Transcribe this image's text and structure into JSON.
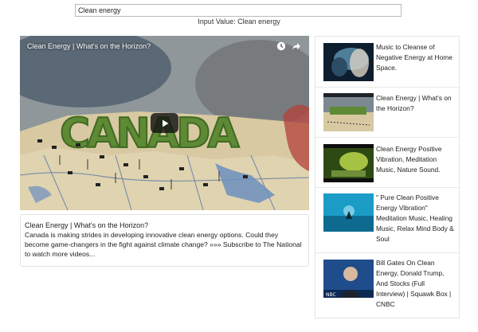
{
  "search": {
    "value": "Clean energy"
  },
  "input_value": {
    "label": "Input Value: Clean energy"
  },
  "player": {
    "title": "Clean Energy | What's on the Horizon?",
    "overlay_text": "CANADA",
    "icons": [
      "clock-icon",
      "share-icon",
      "play-icon"
    ]
  },
  "description": {
    "title": "Clean Energy | What's on the Horizon?",
    "text": "Canada is making strides in developing innovative clean energy options. Could they become game-changers in the fight against climate change? »»» Subscribe to The National to watch more videos..."
  },
  "sidebar": {
    "items": [
      {
        "title": "Music to Cleanse of Negative Energy at Home Space."
      },
      {
        "title": "Clean Energy | What's on the Horizon?"
      },
      {
        "title": "Clean Energy Positive Vibration, Meditation Music, Nature Sound."
      },
      {
        "title": "\" Pure Clean Positive Energy Vibration\" Meditation Music, Healing Music, Relax Mind Body & Soul"
      },
      {
        "title": "Bill Gates On Clean Energy, Donald Trump, And Stocks (Full Interview) | Squawk Box | CNBC",
        "badge": "NBC"
      }
    ]
  }
}
